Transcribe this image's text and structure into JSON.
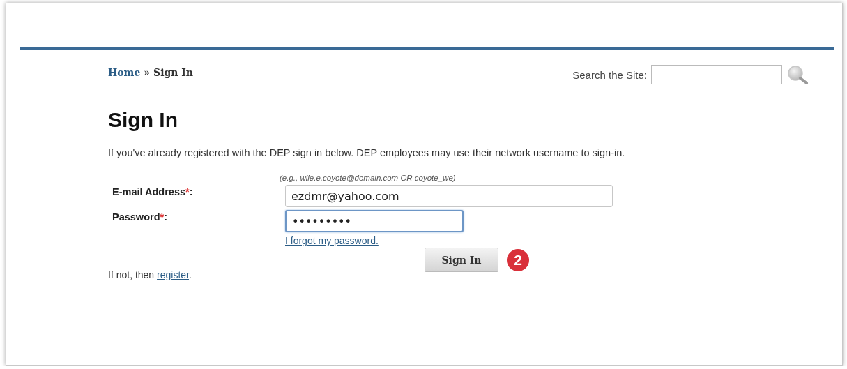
{
  "breadcrumb": {
    "items": [
      {
        "text": "Home",
        "kind": "link"
      },
      {
        "text": "»",
        "kind": "separator"
      },
      {
        "text": "Sign In",
        "kind": "current"
      }
    ]
  },
  "search": {
    "label": "Search the Site:"
  },
  "title": "Sign In",
  "intro": "If you've already registered with the DEP sign in below. DEP employees may use their network username to sign-in.",
  "hint": "(e.g., wile.e.coyote@domain.com OR coyote_we)",
  "fields": [
    {
      "label": "E-mail Address",
      "required_mark": "*",
      "suffix": ":",
      "value": "ezdmr@yahoo.com",
      "kind": "wide",
      "focused": false
    },
    {
      "label": "Password",
      "required_mark": "*",
      "suffix": ":",
      "value": "•••••••••",
      "kind": "narrow",
      "focused": true
    }
  ],
  "forgot_link": "I forgot my password.",
  "submit_button": "Sign In",
  "step_badge": "2",
  "register_line": {
    "before": "If not, then ",
    "link": "register",
    "after": "."
  }
}
